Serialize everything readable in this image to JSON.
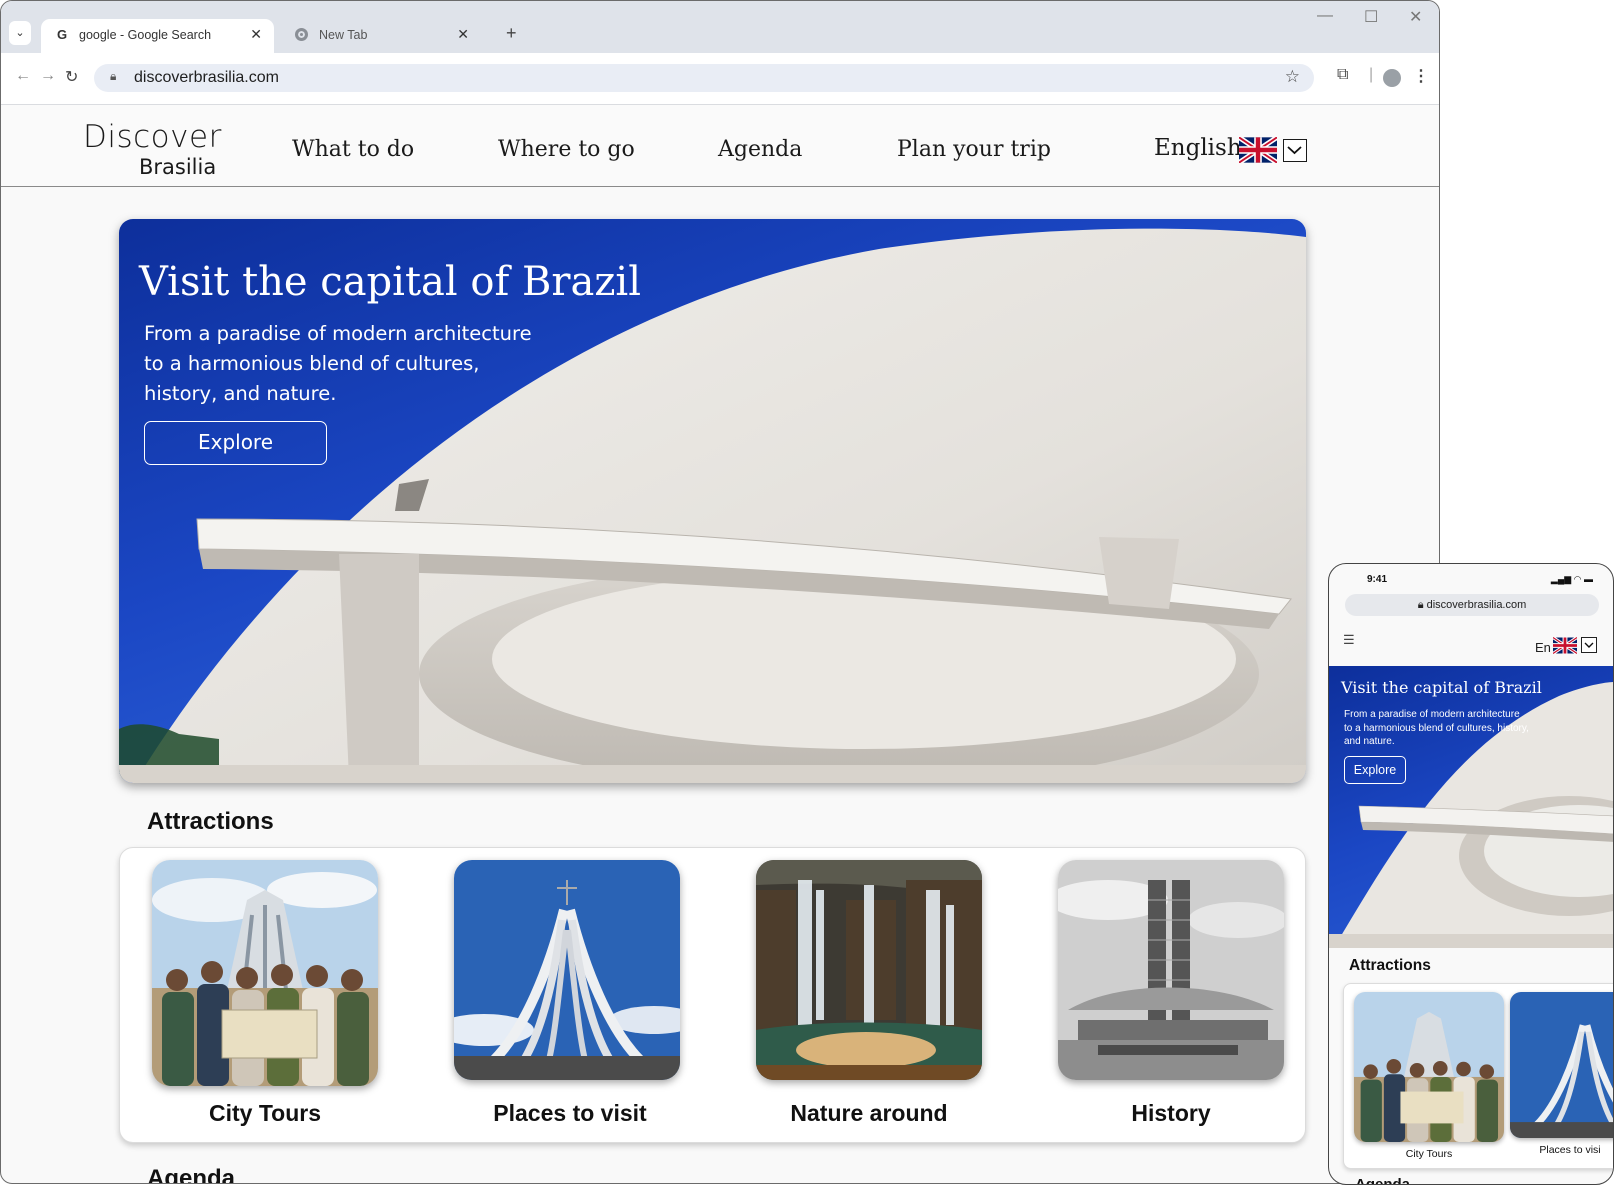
{
  "browser": {
    "tabs": [
      {
        "title": "google - Google Search",
        "favicon": "google-g-icon",
        "active": true
      },
      {
        "title": "New Tab",
        "favicon": "chrome-icon",
        "active": false
      }
    ],
    "address": "discoverbrasilia.com"
  },
  "site": {
    "logo": {
      "line1": "Discover",
      "line2": "Brasilia"
    },
    "nav": [
      "What to do",
      "Where to go",
      "Agenda",
      "Plan your trip"
    ],
    "language": "English",
    "language_short": "En",
    "hero": {
      "title": "Visit the capital of Brazil",
      "subtitle": "From a paradise of modern architecture to a harmonious blend of cultures, history, and nature.",
      "cta": "Explore"
    },
    "attractions_title": "Attractions",
    "attractions": [
      "City Tours",
      "Places to visit",
      "Nature around",
      "History"
    ],
    "agenda_title": "Agenda"
  },
  "phone": {
    "time": "9:41",
    "address": "discoverbrasilia.com",
    "visible_cards": [
      "City Tours",
      "Places to visi"
    ]
  },
  "colors": {
    "sky": "#1b47c4",
    "dome": "#e6e4e0",
    "text": "#111111"
  }
}
